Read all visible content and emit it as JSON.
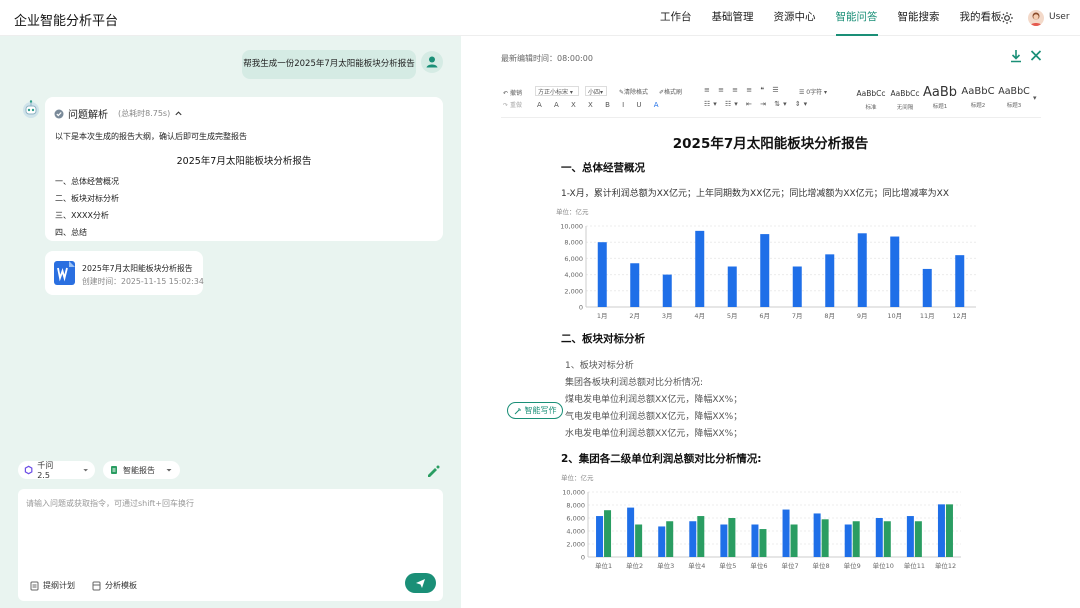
{
  "app": {
    "title": "企业智能分析平台"
  },
  "nav": [
    "工作台",
    "基础管理",
    "资源中心",
    "智能问答",
    "智能搜索",
    "我的看板"
  ],
  "nav_active": "智能问答",
  "user": {
    "name": "User"
  },
  "chat": {
    "user_message": "帮我生成一份2025年7月太阳能板块分析报告",
    "answer": {
      "header": "问题解析",
      "time": "(总耗时8.75s)",
      "intro": "以下是本次生成的报告大纲，确认后即可生成完整报告",
      "report_title": "2025年7月太阳能板块分析报告",
      "outline": [
        "一、总体经营概况",
        "二、板块对标分析",
        "三、XXXX分析",
        "四、总结"
      ]
    },
    "file": {
      "name": "2025年7月太阳能板块分析报告",
      "created": "创建时间：2025-11-15 15:02:34"
    }
  },
  "composer": {
    "model": "千问2.5",
    "mode": "智能报告",
    "placeholder": "请输入问题或获取指令，可通过shift+回车换行",
    "tools": [
      "提纲计划",
      "分析模板"
    ]
  },
  "editor": {
    "last_edit": "最新编辑时间：08:00:00",
    "toolbar": {
      "undo": "撤销",
      "redo": "重做",
      "font": "方正小标宋",
      "size": "小四",
      "clear": "清除格式",
      "painter": "格式刷",
      "line": "0字符",
      "styles": [
        {
          "sample": "AaBbCc",
          "label": "标准"
        },
        {
          "sample": "AaBbCc",
          "label": "无间隔"
        },
        {
          "sample": "AaBb",
          "label": "标题1"
        },
        {
          "sample": "AaBbC",
          "label": "标题2"
        },
        {
          "sample": "AaBbC",
          "label": "标题3"
        }
      ]
    },
    "doc_title": "2025年7月太阳能板块分析报告",
    "section1": "一、总体经营概况",
    "section1_text": "1-X月，累计利润总额为XX亿元；上年同期数为XX亿元；同比增减额为XX亿元；同比增减率为XX",
    "section2": "二、板块对标分析",
    "sub1": "1、板块对标分析",
    "lines": [
      "集团各板块利润总额对比分析情况:",
      "煤电发电单位利润总额XX亿元，降幅XX%；",
      "气电发电单位利润总额XX亿元，降幅XX%；",
      "水电发电单位利润总额XX亿元，降幅XX%；"
    ],
    "sub2": "2、集团各二级单位利润总额对比分析情况:",
    "ai_write": "智能写作"
  },
  "colors": {
    "accent": "#1a8f77",
    "bar_blue": "#1f6fe8",
    "bar_green": "#2a9d62",
    "left_bg": "#e9f4f0"
  },
  "chart_data": [
    {
      "type": "bar",
      "unit_label": "单位：亿元",
      "categories": [
        "1月",
        "2月",
        "3月",
        "4月",
        "5月",
        "6月",
        "7月",
        "8月",
        "9月",
        "10月",
        "11月",
        "12月"
      ],
      "values": [
        8000,
        5400,
        4000,
        9400,
        5000,
        9000,
        5000,
        6500,
        9100,
        8700,
        4700,
        6400
      ],
      "ylim": [
        0,
        10000
      ],
      "yticks": [
        "10,000",
        "8,000",
        "6,000",
        "4,000",
        "2,000",
        "0"
      ],
      "grid": true
    },
    {
      "type": "bar",
      "unit_label": "单位：亿元",
      "categories": [
        "单位1",
        "单位2",
        "单位3",
        "单位4",
        "单位5",
        "单位6",
        "单位7",
        "单位8",
        "单位9",
        "单位10",
        "单位11",
        "单位12"
      ],
      "series": [
        {
          "values": [
            6300,
            7600,
            4700,
            5500,
            5000,
            5000,
            7300,
            6700,
            5000,
            6000,
            6300,
            8100
          ]
        },
        {
          "values": [
            7200,
            5000,
            5500,
            6300,
            6000,
            4300,
            5000,
            5800,
            5500,
            5500,
            5500,
            8100
          ]
        }
      ],
      "ylim": [
        0,
        10000
      ],
      "yticks": [
        "10,000",
        "8,000",
        "6,000",
        "4,000",
        "2,000",
        "0"
      ],
      "grid": true
    }
  ]
}
